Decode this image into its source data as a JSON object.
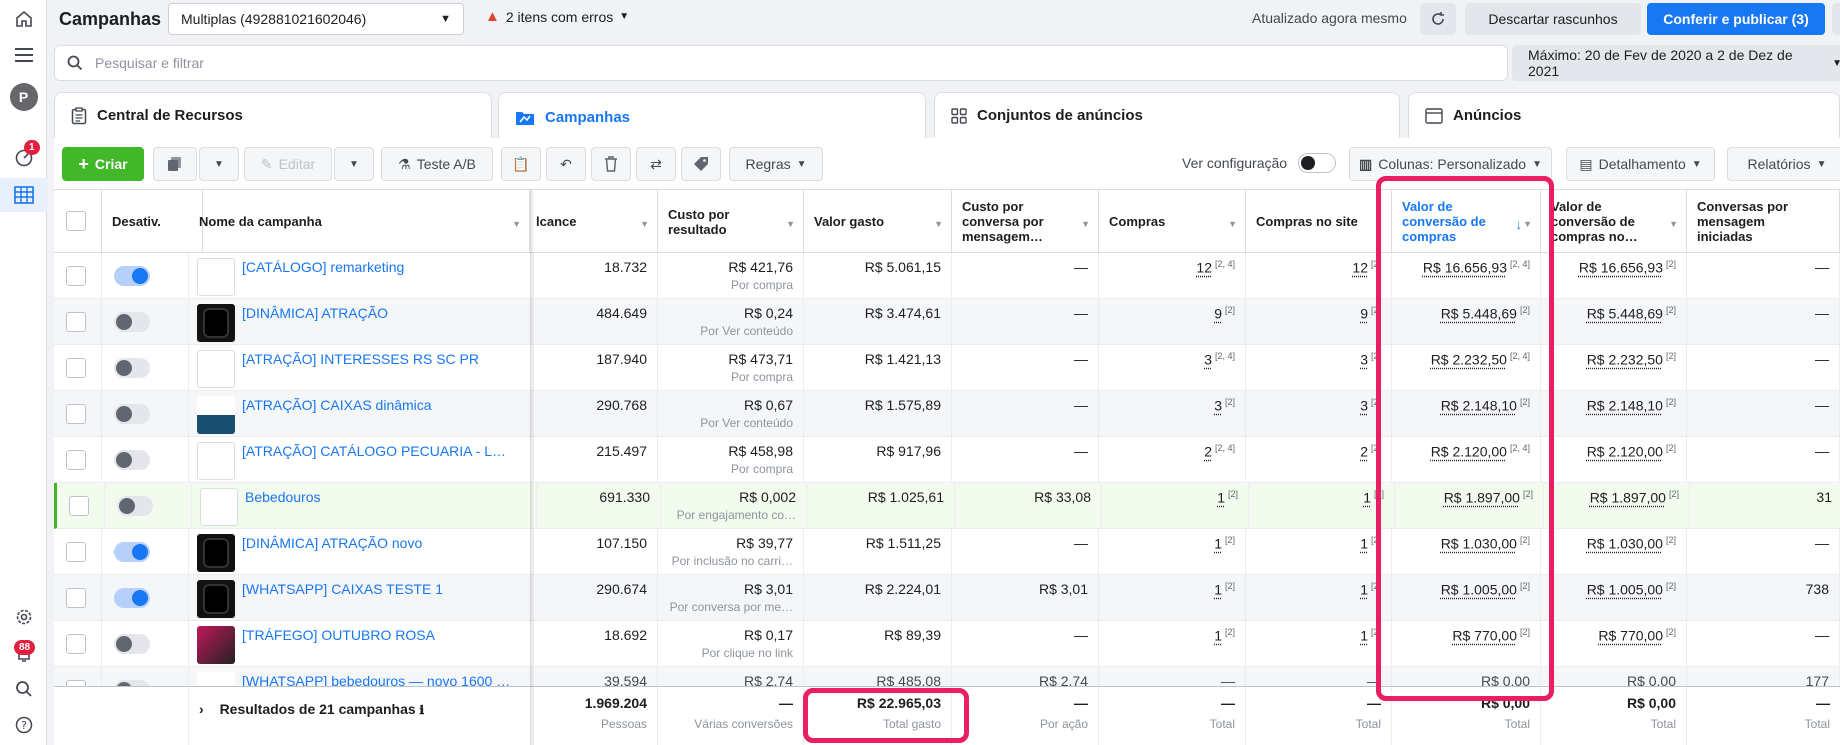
{
  "topbar": {
    "title": "Campanhas",
    "account": "Multiplas (492881021602046)",
    "errors": "2 itens com erros",
    "updated": "Atualizado agora mesmo",
    "discard": "Descartar rascunhos",
    "publish": "Conferir e publicar (3)"
  },
  "rail": {
    "avatar_letter": "P",
    "notif_count": "1",
    "alerts_count": "88"
  },
  "search": {
    "placeholder": "Pesquisar e filtrar",
    "date_range": "Máximo: 20 de Fev de 2020 a 2 de Dez de 2021"
  },
  "tabs": [
    {
      "label": "Central de Recursos",
      "icon": "clipboard-icon"
    },
    {
      "label": "Campanhas",
      "icon": "folder-icon"
    },
    {
      "label": "Conjuntos de anúncios",
      "icon": "grid-icon"
    },
    {
      "label": "Anúncios",
      "icon": "ad-icon"
    }
  ],
  "toolbar": {
    "create": "Criar",
    "edit": "Editar",
    "ab_test": "Teste A/B",
    "rules": "Regras",
    "view_config": "Ver configuração",
    "columns": "Colunas: Personalizado",
    "breakdown": "Detalhamento",
    "reports": "Relatórios"
  },
  "headers": {
    "toggle": "Desativ.",
    "name": "Nome da campanha",
    "reach": "lcance",
    "cost_per_result": "Custo por resultado",
    "spent": "Valor gasto",
    "cost_per_msg": "Custo por conversa por mensagem…",
    "purchases": "Compras",
    "site_purchases": "Compras no site",
    "conv_value": "Valor de conversão de compras",
    "conv_value_site": "Valor de conversão de compras no…",
    "msg_convos": "Conversas por mensagem iniciadas"
  },
  "rows": [
    {
      "on": true,
      "thumb": "blank",
      "name": "[CATÁLOGO] remarketing",
      "reach": "18.732",
      "cpr": "R$ 421,76",
      "cpr_sub": "Por compra",
      "spent": "R$ 5.061,15",
      "cpm": "—",
      "purch": "12",
      "purch_sup": "[2, 4]",
      "site": "12",
      "site_sup": "[2]",
      "conv": "R$ 16.656,93",
      "conv_sup": "[2, 4]",
      "conv_site": "R$ 16.656,93",
      "conv_site_sup": "[2]",
      "msgs": "—"
    },
    {
      "on": false,
      "thumb": "dark",
      "name": "[DINÂMICA] ATRAÇÃO",
      "reach": "484.649",
      "cpr": "R$ 0,24",
      "cpr_sub": "Por Ver conteúdo",
      "spent": "R$ 3.474,61",
      "cpm": "—",
      "purch": "9",
      "purch_sup": "[2]",
      "site": "9",
      "site_sup": "[2]",
      "conv": "R$ 5.448,69",
      "conv_sup": "[2]",
      "conv_site": "R$ 5.448,69",
      "conv_site_sup": "[2]",
      "msgs": "—"
    },
    {
      "on": false,
      "thumb": "blank",
      "name": "[ATRAÇÃO] INTERESSES RS SC PR",
      "reach": "187.940",
      "cpr": "R$ 473,71",
      "cpr_sub": "Por compra",
      "spent": "R$ 1.421,13",
      "cpm": "—",
      "purch": "3",
      "purch_sup": "[2, 4]",
      "site": "3",
      "site_sup": "[2]",
      "conv": "R$ 2.232,50",
      "conv_sup": "[2, 4]",
      "conv_site": "R$ 2.232,50",
      "conv_site_sup": "[2]",
      "msgs": "—"
    },
    {
      "on": false,
      "thumb": "pool",
      "name": "[ATRAÇÃO] CAIXAS dinâmica",
      "reach": "290.768",
      "cpr": "R$ 0,67",
      "cpr_sub": "Por Ver conteúdo",
      "spent": "R$ 1.575,89",
      "cpm": "—",
      "purch": "3",
      "purch_sup": "[2]",
      "site": "3",
      "site_sup": "[2]",
      "conv": "R$ 2.148,10",
      "conv_sup": "[2]",
      "conv_site": "R$ 2.148,10",
      "conv_site_sup": "[2]",
      "msgs": "—"
    },
    {
      "on": false,
      "thumb": "blank",
      "name": "[ATRAÇÃO] CATÁLOGO PECUARIA - LEITE",
      "reach": "215.497",
      "cpr": "R$ 458,98",
      "cpr_sub": "Por compra",
      "spent": "R$ 917,96",
      "cpm": "—",
      "purch": "2",
      "purch_sup": "[2, 4]",
      "site": "2",
      "site_sup": "[2]",
      "conv": "R$ 2.120,00",
      "conv_sup": "[2, 4]",
      "conv_site": "R$ 2.120,00",
      "conv_site_sup": "[2]",
      "msgs": "—"
    },
    {
      "on": false,
      "thumb": "blank",
      "name": "Bebedouros",
      "reach": "691.330",
      "cpr": "R$ 0,002",
      "cpr_sub": "Por engajamento co…",
      "spent": "R$ 1.025,61",
      "cpm": "R$ 33,08",
      "purch": "1",
      "purch_sup": "[2]",
      "site": "1",
      "site_sup": "[2]",
      "conv": "R$ 1.897,00",
      "conv_sup": "[2]",
      "conv_site": "R$ 1.897,00",
      "conv_site_sup": "[2]",
      "msgs": "31"
    },
    {
      "on": true,
      "thumb": "dark",
      "name": "[DINÂMICA] ATRAÇÃO novo",
      "reach": "107.150",
      "cpr": "R$ 39,77",
      "cpr_sub": "Por inclusão no carri…",
      "spent": "R$ 1.511,25",
      "cpm": "—",
      "purch": "1",
      "purch_sup": "[2]",
      "site": "1",
      "site_sup": "[2]",
      "conv": "R$ 1.030,00",
      "conv_sup": "[2]",
      "conv_site": "R$ 1.030,00",
      "conv_site_sup": "[2]",
      "msgs": "—"
    },
    {
      "on": true,
      "thumb": "dark",
      "name": "[WHATSAPP] CAIXAS TESTE 1",
      "reach": "290.674",
      "cpr": "R$ 3,01",
      "cpr_sub": "Por conversa por me…",
      "spent": "R$ 2.224,01",
      "cpm": "R$ 3,01",
      "purch": "1",
      "purch_sup": "[2]",
      "site": "1",
      "site_sup": "[2]",
      "conv": "R$ 1.005,00",
      "conv_sup": "[2]",
      "conv_site": "R$ 1.005,00",
      "conv_site_sup": "[2]",
      "msgs": "738"
    },
    {
      "on": false,
      "thumb": "pink",
      "name": "[TRÁFEGO] OUTUBRO ROSA",
      "reach": "18.692",
      "cpr": "R$ 0,17",
      "cpr_sub": "Por clique no link",
      "spent": "R$ 89,39",
      "cpm": "—",
      "purch": "1",
      "purch_sup": "[2]",
      "site": "1",
      "site_sup": "[2]",
      "conv": "R$ 770,00",
      "conv_sup": "[2]",
      "conv_site": "R$ 770,00",
      "conv_site_sup": "[2]",
      "msgs": "—"
    },
    {
      "on": false,
      "thumb": "pool",
      "name": "[WHATSAPP] bebedouros — novo 1600 li…",
      "reach": "39.594",
      "cpr": "R$ 2,74",
      "cpr_sub": "",
      "spent": "R$ 485,08",
      "cpm": "R$ 2,74",
      "purch": "—",
      "purch_sup": "",
      "site": "—",
      "site_sup": "",
      "conv": "R$ 0,00",
      "conv_sup": "",
      "conv_site": "R$ 0,00",
      "conv_site_sup": "",
      "msgs": "177"
    }
  ],
  "footer": {
    "label": "Resultados de 21 campanhas",
    "reach": "1.969.204",
    "reach_sub": "Pessoas",
    "cpr": "—",
    "cpr_sub": "Várias conversões",
    "spent": "R$ 22.965,03",
    "spent_sub": "Total gasto",
    "cpm": "—",
    "cpm_sub": "Por ação",
    "purch": "—",
    "purch_sub": "Total",
    "site": "—",
    "site_sub": "Total",
    "conv": "R$ 0,00",
    "conv_sub": "Total",
    "conv_site": "R$ 0,00",
    "conv_site_sub": "Total",
    "msgs": "—",
    "msgs_sub": "Total"
  },
  "colors": {
    "accent": "#1877f2",
    "create": "#42b72a",
    "highlight": "#e91e63"
  }
}
